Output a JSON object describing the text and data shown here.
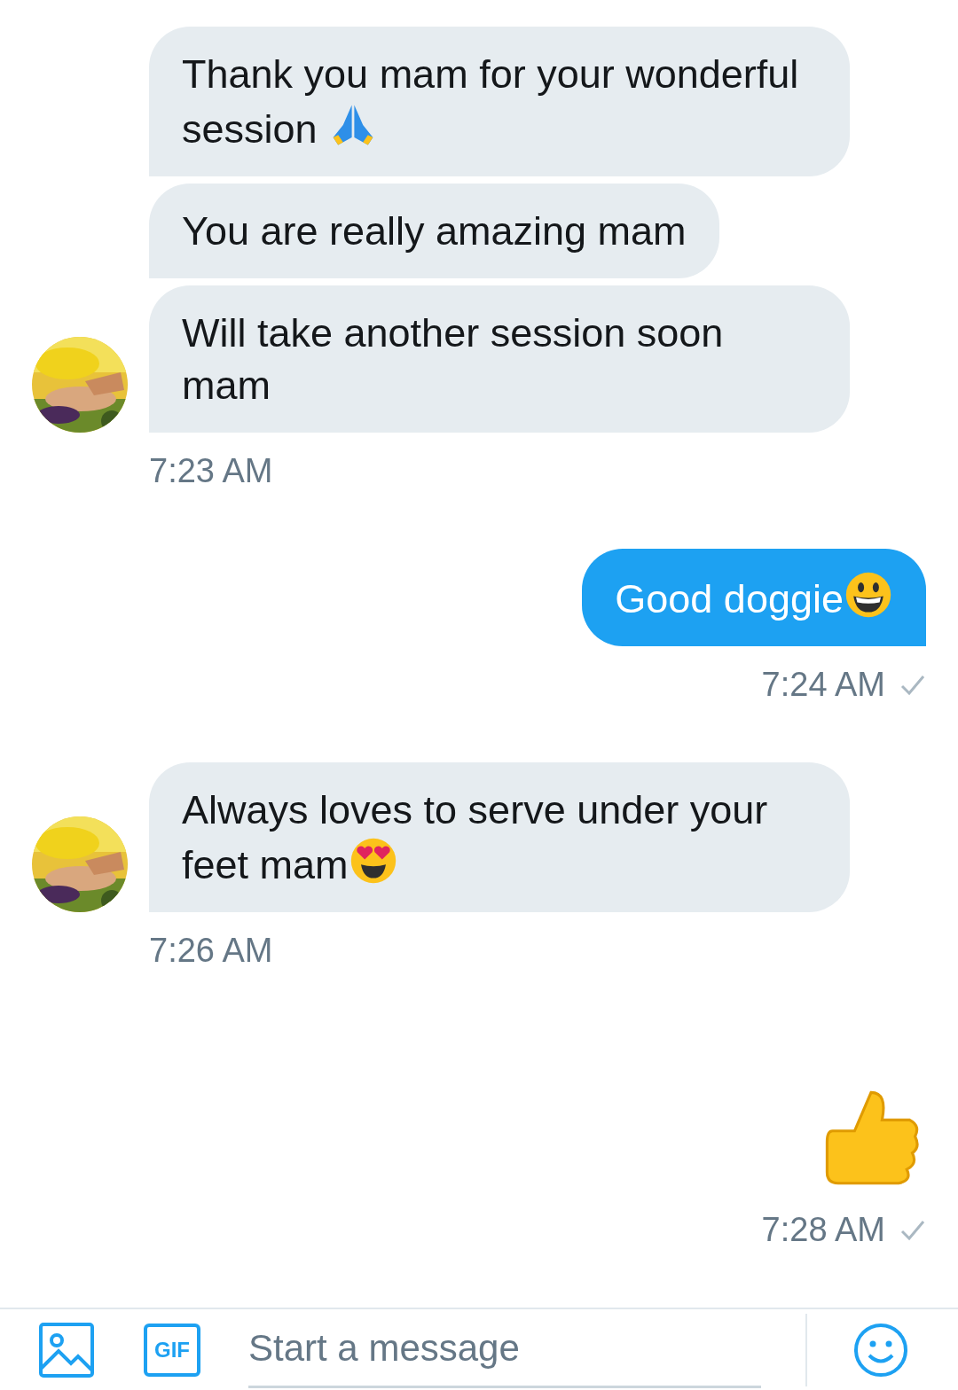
{
  "groups": [
    {
      "kind": "received",
      "avatar": true,
      "time": "7:23 AM",
      "delivered": false,
      "messages": [
        {
          "kind": "text",
          "text": "Thank you mam for your wonderful session ",
          "emoji": {
            "kind": "pray"
          }
        },
        {
          "kind": "text",
          "text": "You are really amazing mam"
        },
        {
          "kind": "text",
          "text": "Will take another session soon mam"
        }
      ]
    },
    {
      "kind": "sent",
      "avatar": false,
      "time": "7:24 AM",
      "delivered": true,
      "messages": [
        {
          "kind": "text",
          "text": "Good doggie",
          "emoji": {
            "kind": "grin"
          }
        }
      ]
    },
    {
      "kind": "received",
      "avatar": true,
      "time": "7:26 AM",
      "delivered": false,
      "messages": [
        {
          "kind": "text",
          "text": "Always loves to serve under your feet mam",
          "emoji": {
            "kind": "hearteyes"
          }
        }
      ]
    },
    {
      "kind": "sent",
      "avatar": false,
      "time": "7:28 AM",
      "delivered": true,
      "messages": [
        {
          "kind": "emoji",
          "emoji": {
            "kind": "thumbsup"
          }
        }
      ]
    }
  ],
  "composer": {
    "placeholder": "Start a message",
    "gif_label": "GIF"
  }
}
